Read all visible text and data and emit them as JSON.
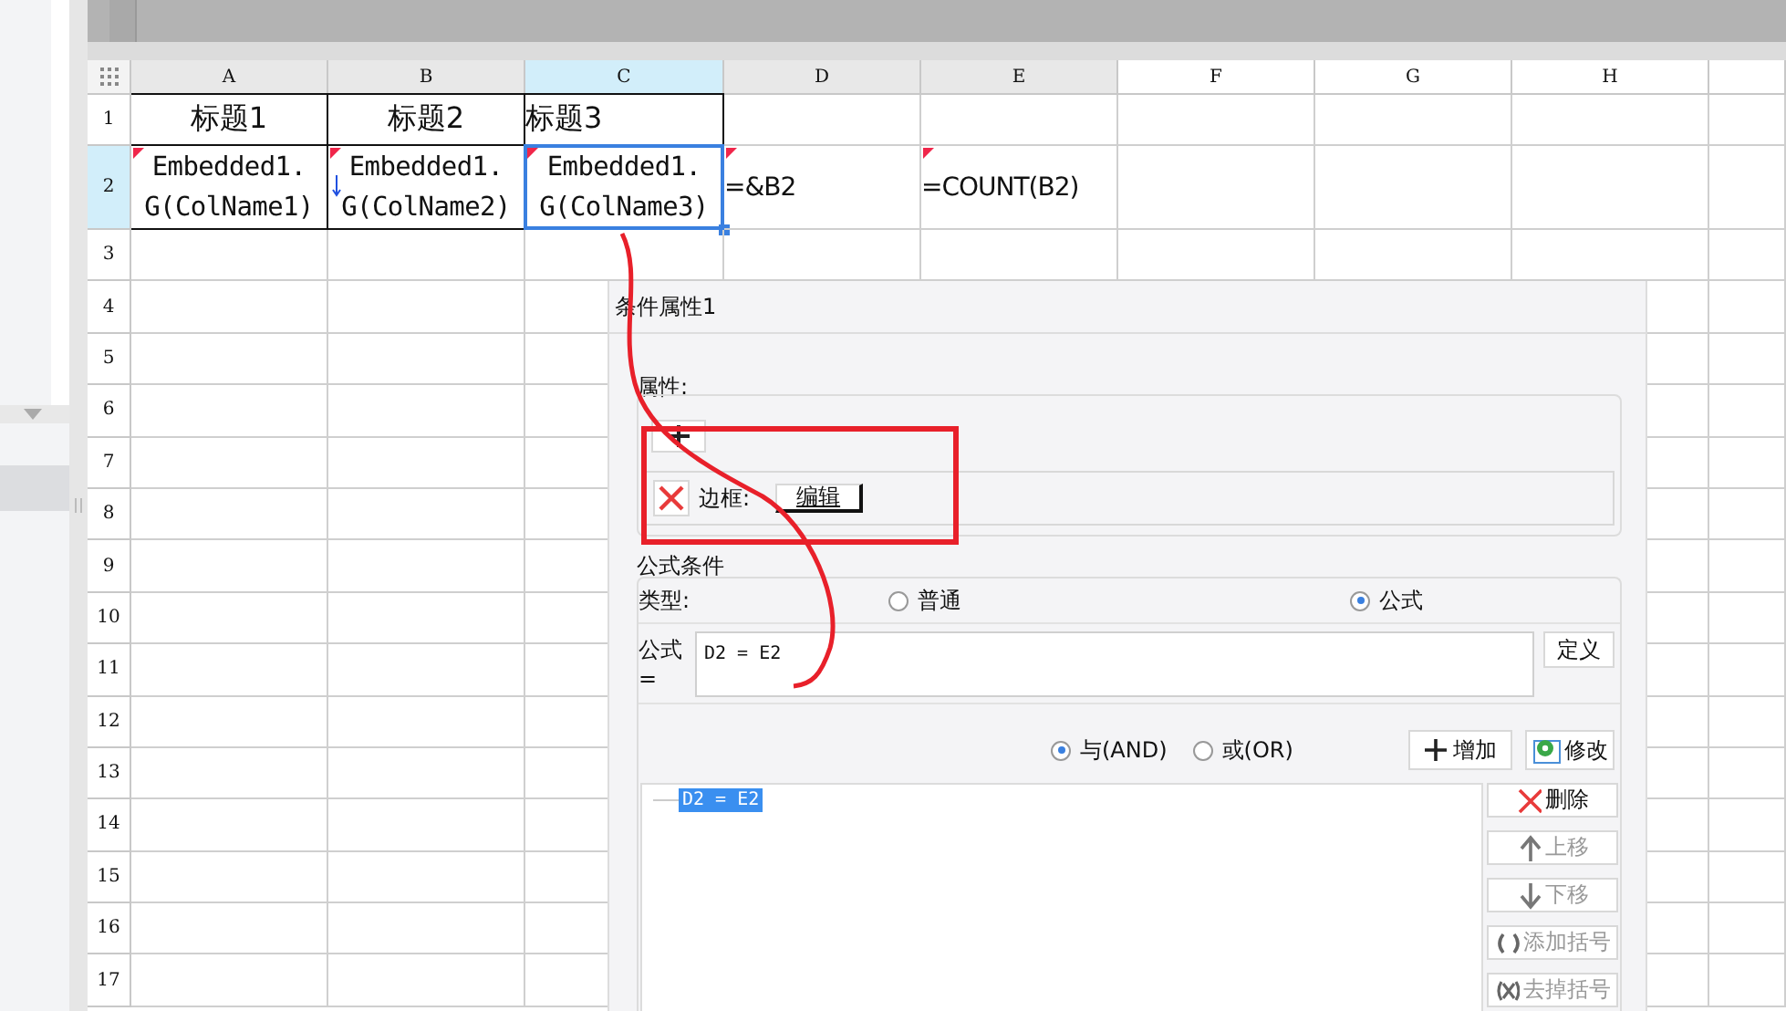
{
  "sheet": {
    "columns": [
      {
        "label": "A",
        "selected": false,
        "used": true
      },
      {
        "label": "B",
        "selected": false,
        "used": true
      },
      {
        "label": "C",
        "selected": true,
        "used": true
      },
      {
        "label": "D",
        "selected": false,
        "used": true
      },
      {
        "label": "E",
        "selected": false,
        "used": true
      },
      {
        "label": "F",
        "selected": false,
        "used": false
      },
      {
        "label": "G",
        "selected": false,
        "used": false
      },
      {
        "label": "H",
        "selected": false,
        "used": false
      }
    ],
    "rows": [
      {
        "label": "1",
        "selected": false,
        "cells": [
          {
            "text": "标题1",
            "kind": "title",
            "centered": true,
            "bordered": true,
            "flagged": false,
            "expand_marker": false,
            "selected": false
          },
          {
            "text": "标题2",
            "kind": "title",
            "centered": true,
            "bordered": true,
            "flagged": false,
            "expand_marker": false,
            "selected": false
          },
          {
            "text": "标题3",
            "kind": "title",
            "centered": false,
            "bordered": true,
            "flagged": false,
            "expand_marker": false,
            "selected": false
          }
        ]
      },
      {
        "label": "2",
        "selected": true,
        "cells": [
          {
            "text": "Embedded1.\nG(ColName1)",
            "kind": "field",
            "centered": true,
            "bordered": true,
            "flagged": true,
            "expand_marker": false,
            "selected": false
          },
          {
            "text": "Embedded1.\nG(ColName2)",
            "kind": "field",
            "centered": true,
            "bordered": true,
            "flagged": true,
            "expand_marker": true,
            "selected": false
          },
          {
            "text": "Embedded1.\nG(ColName3)",
            "kind": "field",
            "centered": true,
            "bordered": true,
            "flagged": true,
            "expand_marker": false,
            "selected": true
          },
          {
            "text": "=&B2",
            "kind": "formula",
            "centered": false,
            "bordered": false,
            "flagged": true,
            "expand_marker": false,
            "selected": false
          },
          {
            "text": "=COUNT(B2)",
            "kind": "formula",
            "centered": false,
            "bordered": false,
            "flagged": true,
            "expand_marker": false,
            "selected": false
          }
        ]
      },
      {
        "label": "3",
        "selected": false
      },
      {
        "label": "4",
        "selected": false
      },
      {
        "label": "5",
        "selected": false
      },
      {
        "label": "6",
        "selected": false
      },
      {
        "label": "7",
        "selected": false
      },
      {
        "label": "8",
        "selected": false
      },
      {
        "label": "9",
        "selected": false
      },
      {
        "label": "10",
        "selected": false
      },
      {
        "label": "11",
        "selected": false
      },
      {
        "label": "12",
        "selected": false
      },
      {
        "label": "13",
        "selected": false
      },
      {
        "label": "14",
        "selected": false
      },
      {
        "label": "15",
        "selected": false
      },
      {
        "label": "16",
        "selected": false
      },
      {
        "label": "17",
        "selected": false
      }
    ]
  },
  "dialog": {
    "title": "条件属性1",
    "attributes": {
      "label": "属性:",
      "items": [
        {
          "label": "边框:",
          "button": "编辑"
        }
      ]
    },
    "formula_condition": {
      "label": "公式条件",
      "type_label": "类型:",
      "types": [
        {
          "label": "普通",
          "selected": false
        },
        {
          "label": "公式",
          "selected": true
        }
      ],
      "formula_label": "公式=",
      "formula": "D2 = E2",
      "define_button": "定义",
      "logic": [
        {
          "label": "与(AND)",
          "selected": true
        },
        {
          "label": "或(OR)",
          "selected": false
        }
      ],
      "add_button": "增加",
      "modify_button": "修改",
      "conditions": [
        {
          "text": "D2 = E2",
          "selected": true
        }
      ],
      "side_buttons": [
        {
          "label": "删除",
          "kind": "delete",
          "disabled": false
        },
        {
          "label": "上移",
          "kind": "up",
          "disabled": true
        },
        {
          "label": "下移",
          "kind": "down",
          "disabled": true
        },
        {
          "label": "添加括号",
          "kind": "add-brackets",
          "disabled": true
        },
        {
          "label": "去掉括号",
          "kind": "remove-brackets",
          "disabled": true
        }
      ]
    }
  }
}
